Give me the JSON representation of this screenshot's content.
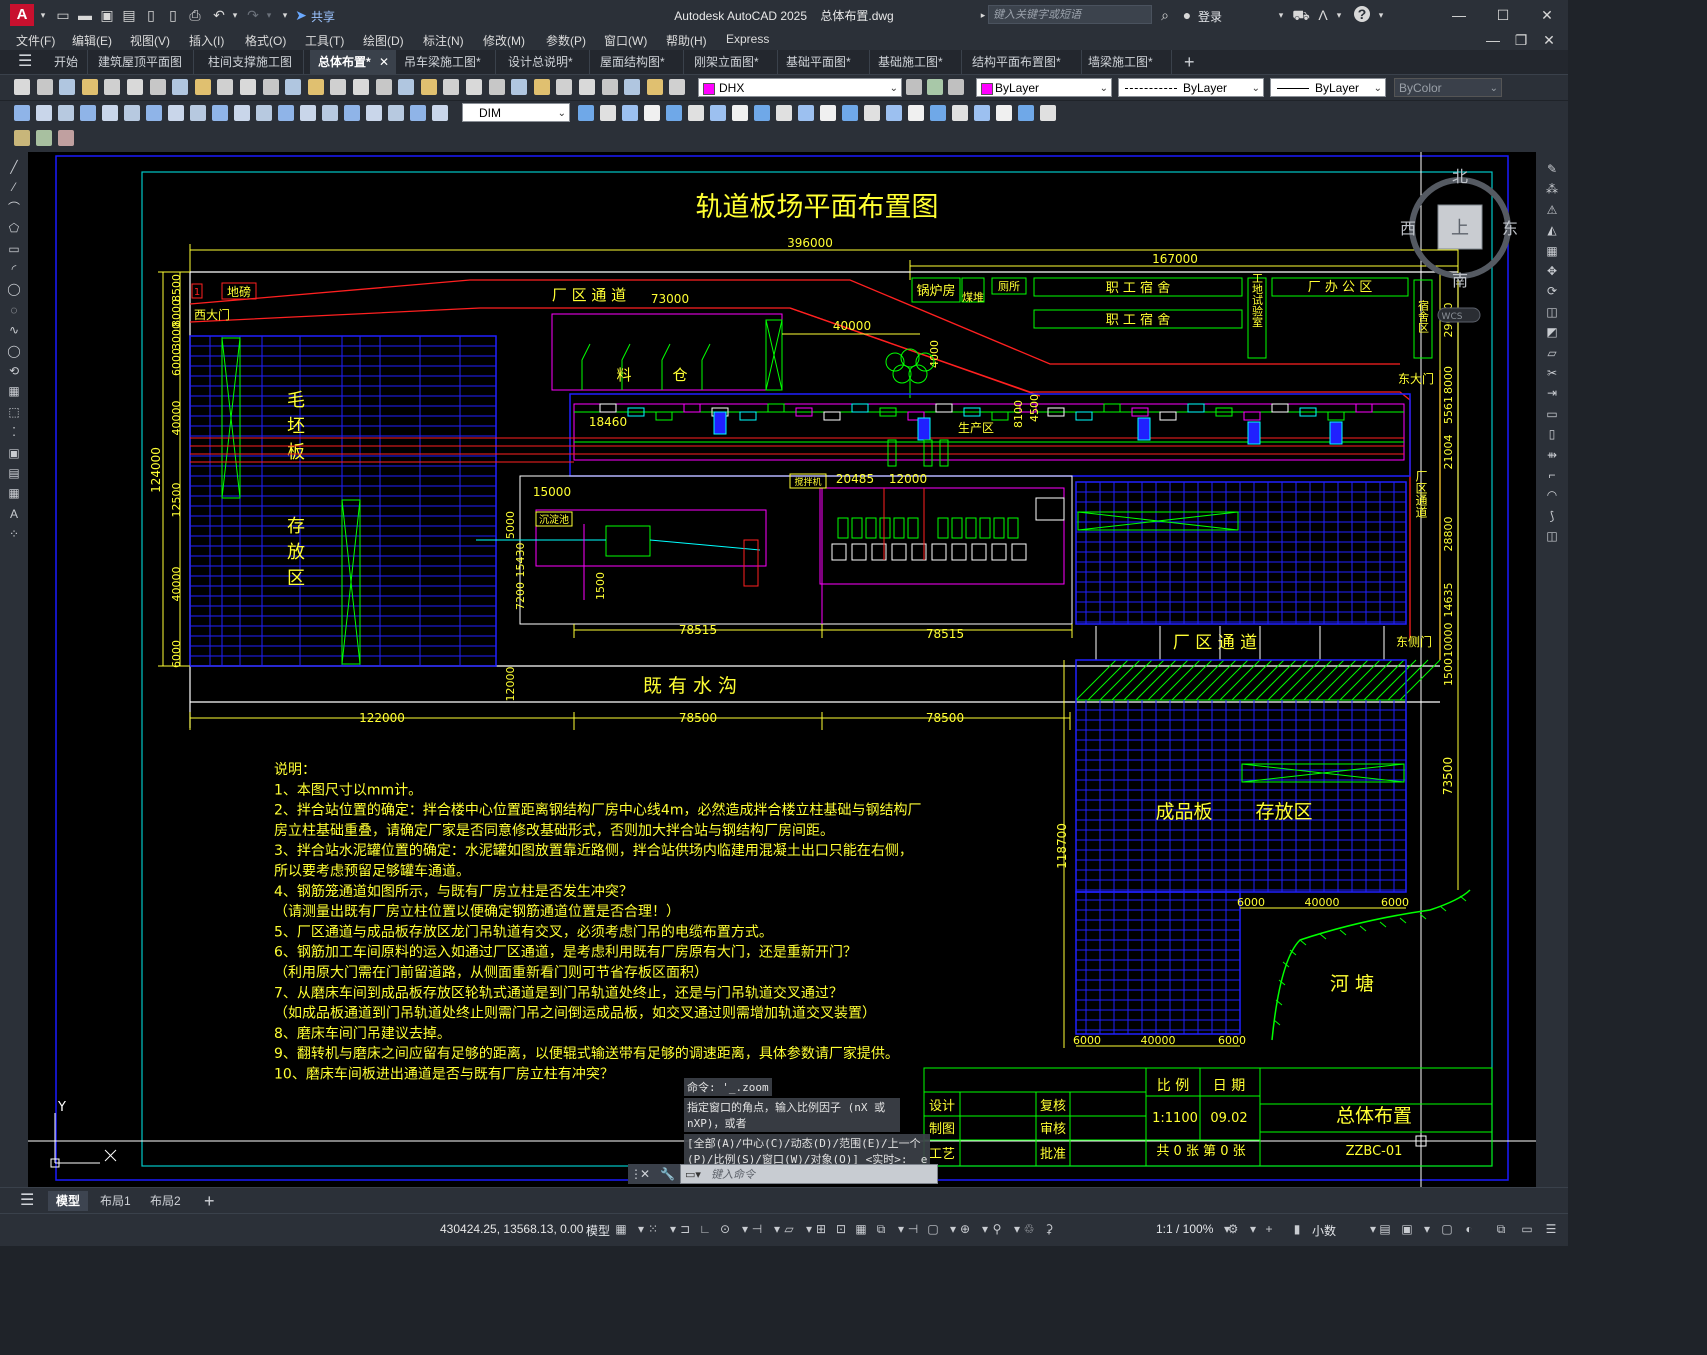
{
  "titlebar": {
    "app_name": "Autodesk AutoCAD 2025",
    "file_name": "总体布置.dwg",
    "share_label": "共享",
    "search_placeholder": "键入关键字或短语",
    "login_label": "登录"
  },
  "menus": [
    "文件(F)",
    "编辑(E)",
    "视图(V)",
    "插入(I)",
    "格式(O)",
    "工具(T)",
    "绘图(D)",
    "标注(N)",
    "修改(M)",
    "参数(P)",
    "窗口(W)",
    "帮助(H)",
    "Express"
  ],
  "doc_tabs": [
    {
      "label": "开始",
      "active": false
    },
    {
      "label": "建筑屋顶平面图",
      "active": false
    },
    {
      "label": "柱间支撑施工图",
      "active": false
    },
    {
      "label": "总体布置*",
      "active": true
    },
    {
      "label": "吊车梁施工图*",
      "active": false
    },
    {
      "label": "设计总说明*",
      "active": false
    },
    {
      "label": "屋面结构图*",
      "active": false
    },
    {
      "label": "刚架立面图*",
      "active": false
    },
    {
      "label": "基础平面图*",
      "active": false
    },
    {
      "label": "基础施工图*",
      "active": false
    },
    {
      "label": "结构平面布置图*",
      "active": false
    },
    {
      "label": "墙梁施工图*",
      "active": false
    }
  ],
  "properties": {
    "layer": "DHX",
    "color": "ByLayer",
    "linetype": "ByLayer",
    "lineweight": "ByLayer",
    "plotstyle": "ByColor",
    "dimstyle": "DIM",
    "layer_color": "#ff00ff"
  },
  "viewcube": {
    "north": "北",
    "south": "南",
    "east": "东",
    "west": "西",
    "face": "上",
    "wcs": "WCS"
  },
  "drawing": {
    "title": "轨道板场平面布置图",
    "dims": {
      "overall": "396000",
      "right_top": "167000",
      "d73000": "73000",
      "d40000": "40000",
      "d4000": "4000",
      "d18460": "18460",
      "d15000": "15000",
      "d20485": "20485",
      "d12000": "12000",
      "d78515a": "78515",
      "d78515b": "78515",
      "bottom_122000": "122000",
      "bottom_78500a": "78500",
      "bottom_78500b": "78500",
      "left_124000": "124000",
      "left_12500": "12500",
      "left_40000a": "40000",
      "left_40000b": "40000",
      "left_6000a": "6000",
      "left_6000b": "6000",
      "left_8000": "8000",
      "left_8500": "8500",
      "left_3000": "3000",
      "mid_12000": "12000",
      "mid_15430": "15430",
      "mid_7200": "7200",
      "mid_1500": "1500",
      "mid_5000": "5000",
      "right_29000": "29000",
      "right_8000": "8000",
      "right_5561": "5561",
      "right_21004": "21004",
      "right_28800": "28800",
      "right_14635": "14635",
      "right_10000": "10000",
      "right_1500": "1500",
      "right_73500": "73500",
      "left_118700": "118700",
      "b6000a": "6000",
      "b40000a": "40000",
      "b6000b": "6000",
      "b6000c": "6000",
      "b40000b": "40000",
      "b6000d": "6000",
      "d8100": "8100",
      "d4500": "4500"
    },
    "labels": {
      "dibang": "地磅",
      "marker1": "1",
      "west_gate": "西大门",
      "factory_road_top": "厂 区 通 道",
      "boiler": "锅炉房",
      "coal": "煤堆",
      "toilet": "厕所",
      "dorm1": "职 工 宿 舍",
      "dorm2": "职 工 宿 舍",
      "lab": "工地试验室",
      "office": "厂 办 公 区",
      "dorm_area": "宿舍区",
      "east_gate": "东大门",
      "material1": "料",
      "material2": "仓",
      "production": "生产区",
      "mixing": "搅拌机",
      "settle": "沉淀池",
      "blank1": "毛",
      "blank2": "坯",
      "blank3": "板",
      "store1": "存",
      "store2": "放",
      "store3": "区",
      "right_road": "厂区通道",
      "factory_road_mid": "厂 区 通 道",
      "east_side_gate": "东侧门",
      "ditch": "既 有 水 沟",
      "finished": "成品板",
      "finished_store": "存放区",
      "pond": "河 塘"
    },
    "notes": [
      "说明：",
      "1、本图尺寸以mm计。",
      "2、拌合站位置的确定：拌合楼中心位置距离钢结构厂房中心线4m，必然造成拌合楼立柱基础与钢结构厂",
      "房立柱基础重叠，请确定厂家是否同意修改基础形式，否则加大拌合站与钢结构厂房间距。",
      "3、拌合站水泥罐位置的确定：水泥罐如图放置靠近路侧，拌合站供场内临建用混凝土出口只能在右侧，",
      "所以要考虑预留足够罐车通道。",
      "4、钢筋笼通道如图所示，与既有厂房立柱是否发生冲突？",
      "  （请测量出既有厂房立柱位置以便确定钢筋通道位置是否合理！）",
      "5、厂区通道与成品板存放区龙门吊轨道有交叉，必须考虑门吊的电缆布置方式。",
      "6、钢筋加工车间原料的运入如通过厂区通道，是考虑利用既有厂房原有大门，还是重新开门？",
      "（利用原大门需在门前留道路，从侧面重新看门则可节省存板区面积）",
      "7、从磨床车间到成品板存放区轮轨式通道是到门吊轨道处终止，还是与门吊轨道交叉通过？",
      "（如成品板通道到门吊轨道处终止则需门吊之间倒运成品板，如交叉通过则需增加轨道交叉装置）",
      "8、磨床车间门吊建议去掉。",
      "9、翻转机与磨床之间应留有足够的距离，以便辊式输送带有足够的调速距离，具体参数请厂家提供。",
      "10、磨床车间板进出通道是否与既有厂房立柱有冲突？"
    ],
    "titleblock": {
      "scale_label": "比 例",
      "date_label": "日 期",
      "design": "设计",
      "review": "复核",
      "drawing": "制图",
      "audit": "审核",
      "process": "工艺",
      "approve": "批准",
      "scale": "1:1100",
      "date": "09.02",
      "name": "总体布置",
      "sheets": "共 0 张 第 0 张",
      "code": "ZZBC-01"
    },
    "ucs_y": "Y"
  },
  "command": {
    "history": [
      "命令: '_.zoom",
      "指定窗口的角点，输入比例因子 (nX 或\nnXP)，或者",
      "[全部(A)/中心(C)/动态(D)/范围(E)/上一个\n(P)/比例(S)/窗口(W)/对象(O)] <实时>: _e"
    ],
    "placeholder": "键入命令"
  },
  "layout_tabs": [
    {
      "label": "模型",
      "active": true
    },
    {
      "label": "布局1",
      "active": false
    },
    {
      "label": "布局2",
      "active": false
    }
  ],
  "status": {
    "coords": "430424.25, 13568.13, 0.00",
    "model": "模型",
    "scale": "1:1 / 100%",
    "units": "小数"
  }
}
